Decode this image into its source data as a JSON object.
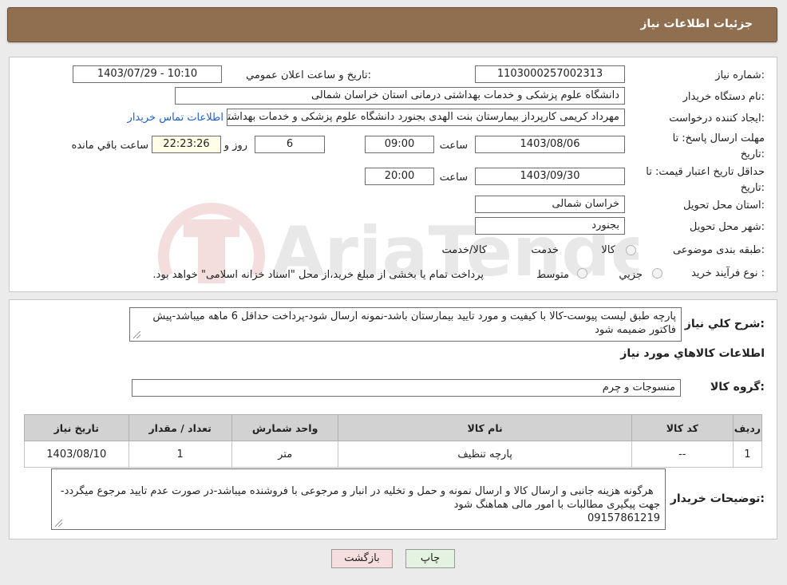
{
  "header": {
    "title": "جزئیات اطلاعات نیاز"
  },
  "form": {
    "need_number_label": "شماره نیاز:",
    "need_number": "1103000257002313",
    "announce_label": "تاریخ و ساعت اعلان عمومي:",
    "announce_value": "1403/07/29 - 10:10",
    "buyer_org_label": "نام دستگاه خريدار:",
    "buyer_org": "دانشگاه علوم پزشکی و خدمات بهداشتی درمانی استان خراسان شمالی",
    "creator_label": "ايجاد کننده درخواست:",
    "creator": "مهرداد کریمی کارپرداز بیمارستان بنت الهدی بجنورد دانشگاه علوم پزشکی و خدمات بهداشتی",
    "contact_link": "اطلاعات تماس خريدار",
    "deadline_label_1": "مهلت ارسال پاسخ: تا",
    "deadline_label_2": "تاريخ:",
    "deadline_date": "1403/08/06",
    "time_label": "ساعت",
    "deadline_time": "09:00",
    "days_value": "6",
    "days_label": "روز و",
    "remaining_time": "22:23:26",
    "remaining_label": "ساعت باقي مانده",
    "validity_label_1": "حداقل تاريخ اعتبار قيمت: تا",
    "validity_label_2": "تاريخ:",
    "validity_date": "1403/09/30",
    "validity_time_label": "ساعت",
    "validity_time": "20:00",
    "province_label": "استان محل تحويل:",
    "province": "خراسان شمالی",
    "city_label": "شهر محل تحويل:",
    "city": "بجنورد",
    "category_label": "طبقه بندی موضوعی:",
    "category_options": [
      "کالا",
      "خدمت",
      "کالا/خدمت"
    ],
    "process_label": "نوع فرآيند خريد :",
    "process_options": [
      "جزيي",
      "متوسط"
    ],
    "process_note": "پرداخت تمام یا بخشی از مبلغ خرید،از محل \"اسناد خزانه اسلامی\" خواهد بود."
  },
  "details": {
    "summary_label": "شرح کلي نياز:",
    "summary": "پارچه طبق لیست پیوست-کالا با کیفیت و مورد تایید بیمارستان باشد-نمونه ارسال شود-پرداخت حداقل 6 ماهه میباشد-پیش فاکتور ضمیمه شود",
    "goods_info_title": "اطلاعات کالاهاي مورد نياز",
    "goods_group_label": "گروه کالا:",
    "goods_group": "منسوجات و چرم",
    "table": {
      "headers": [
        "رديف",
        "کد کالا",
        "نام کالا",
        "واحد شمارش",
        "تعداد / مقدار",
        "تاريخ نياز"
      ],
      "rows": [
        [
          "1",
          "--",
          "پارچه تنظیف",
          "متر",
          "1",
          "1403/08/10"
        ]
      ]
    },
    "buyer_notes_label": "توضيحات خريدار:",
    "buyer_notes": "هرگونه هزینه جانبی و ارسال کالا و ارسال نمونه و حمل و تخلیه در انبار و مرجوعی با فروشنده میباشد-در صورت عدم تایید مرجوع میگردد-جهت پیگیری مطالبات با امور مالی هماهنگ شود\n09157861219"
  },
  "buttons": {
    "print": "چاپ",
    "back": "بازگشت"
  },
  "watermark": "AriaTender.neT",
  "colors": {
    "title_bar": "#8f6f4f",
    "link": "#1f5fd1",
    "back_button": "#f7dede",
    "print_button": "#e3f3df"
  }
}
